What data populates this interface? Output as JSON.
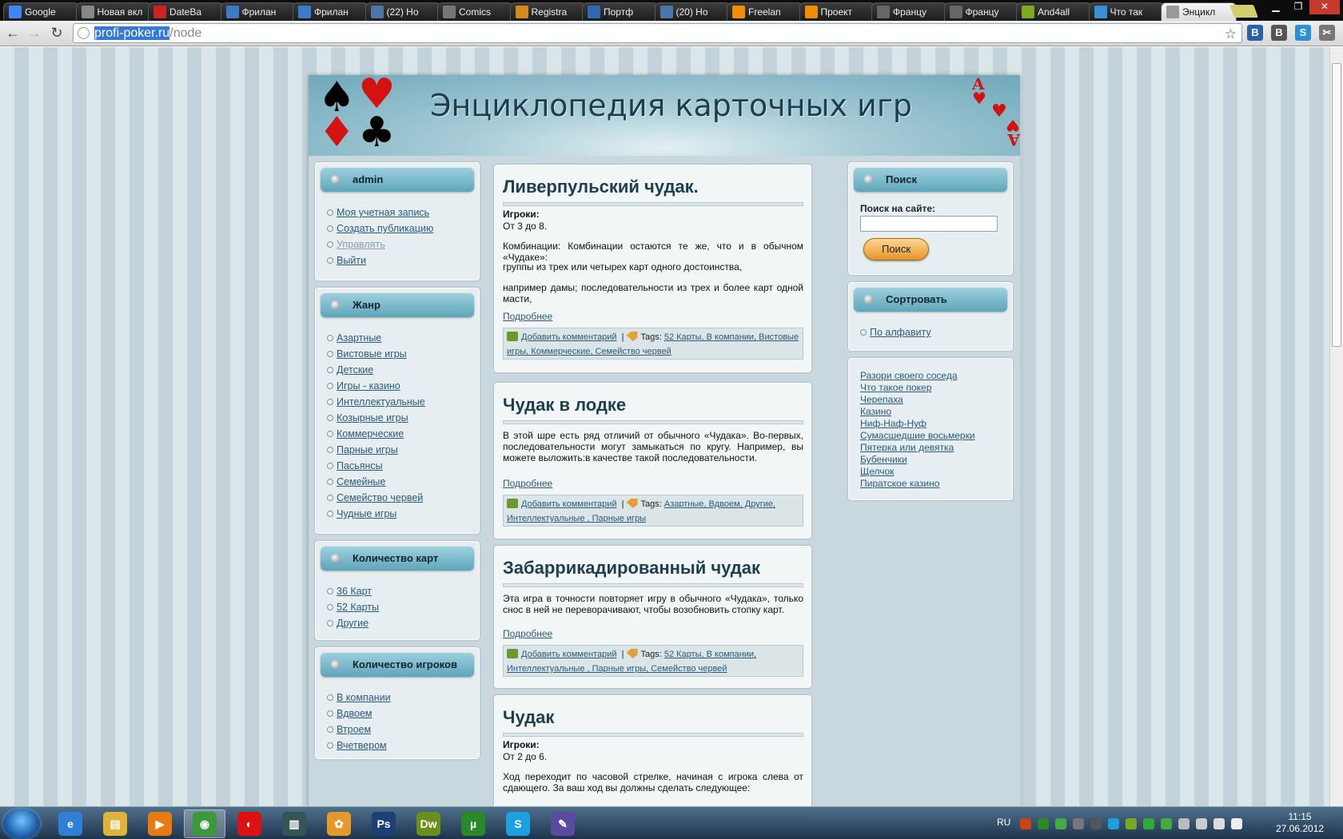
{
  "browser": {
    "tabs": [
      {
        "title": "Google",
        "icon": "google-icon",
        "color": "#4285f4"
      },
      {
        "title": "Новая вкл",
        "icon": "blank-page-icon",
        "color": "#888888"
      },
      {
        "title": "DateBa",
        "icon": "b-red-icon",
        "color": "#c22"
      },
      {
        "title": "Фрилан",
        "icon": "freelance-icon",
        "color": "#3a7bc8"
      },
      {
        "title": "Фрилан",
        "icon": "freelance-icon",
        "color": "#3a7bc8"
      },
      {
        "title": "(22) Но",
        "icon": "vk-icon",
        "color": "#4a76a8"
      },
      {
        "title": "Comics",
        "icon": "comics-icon",
        "color": "#777"
      },
      {
        "title": "Registra",
        "icon": "registration-icon",
        "color": "#d58a1a"
      },
      {
        "title": "Портф",
        "icon": "portfolio-icon",
        "color": "#2f69b0"
      },
      {
        "title": "(20) Но",
        "icon": "vk-icon",
        "color": "#4a76a8"
      },
      {
        "title": "Freelan",
        "icon": "f-orange-icon",
        "color": "#f28c00"
      },
      {
        "title": "Проект",
        "icon": "f-orange-icon",
        "color": "#f28c00"
      },
      {
        "title": "Францу",
        "icon": "french-icon",
        "color": "#666"
      },
      {
        "title": "Францу",
        "icon": "french-icon",
        "color": "#666"
      },
      {
        "title": "And4all",
        "icon": "android-icon",
        "color": "#7aaa22"
      },
      {
        "title": "Что так",
        "icon": "water-icon",
        "color": "#3b8fd6"
      },
      {
        "title": "Энцикл",
        "icon": "spade-icon",
        "color": "#999"
      }
    ],
    "url_host": "profi-poker.ru",
    "url_path": "/node",
    "extensions": [
      {
        "label": "В",
        "color": "#2a62a8"
      },
      {
        "label": "В",
        "color": "#555555"
      },
      {
        "label": "S",
        "color": "#2d8fd8"
      },
      {
        "label": "✂",
        "color": "#777777"
      }
    ]
  },
  "site": {
    "title": "Энциклопедия карточных игр"
  },
  "left": {
    "user": {
      "title": "admin",
      "items": [
        "Моя учетная запись",
        "Создать публикацию",
        "Управлять",
        "Выйти"
      ]
    },
    "genre": {
      "title": "Жанр",
      "items": [
        "Азартные",
        "Вистовые игры",
        "Детские",
        "Игры - казино",
        "Интеллектуальные",
        "Козырные игры",
        "Коммерческие",
        "Парные игры",
        "Пасьянсы",
        "Семейные",
        "Семейство червей",
        "Чудные игры"
      ]
    },
    "cards": {
      "title": "Количество карт",
      "items": [
        "36 Карт",
        "52 Карты",
        "Другие"
      ]
    },
    "players": {
      "title": "Количество игроков",
      "items": [
        "В компании",
        "Вдвоем",
        "Втроем",
        "Вчетвером"
      ]
    }
  },
  "nodes": [
    {
      "title": "Ливерпульский чудак.",
      "label": "Игроки:",
      "range": "От 3 до 8.",
      "p1": "Комбинации: Комбинации остаются те же, что и в обычном «Чудаке»:",
      "p2": "группы из трех или четырех карт одного достоинства,",
      "p3": "например дамы; последовательности из трех и более карт одной масти,",
      "more": "Подробнее",
      "comment": "Добавить комментарий",
      "tags_label": "Tags:",
      "tags": "52 Карты, В компании, Вистовые игры, Коммерческие, Семейство червей"
    },
    {
      "title": "Чудак в лодке",
      "p1": "В этой шре есть ряд отличий от обычного «Чудака». Во-первых, последовательности могут замыкаться по кругу. Например, вы можете выложить:в качестве такой последовательности.",
      "more": "Подробнее",
      "comment": "Добавить комментарий",
      "tags_label": "Tags:",
      "tags": "Азартные, Вдвоем, Другие, Интеллектуальные , Парные игры"
    },
    {
      "title": "Забаррикадированный чудак",
      "p1": "Эта игра в точности повторяет игру в обычного «Чудака», только снос в ней не переворачивают, чтобы возобновить стопку карт.",
      "more": "Подробнее",
      "comment": "Добавить комментарий",
      "tags_label": "Tags:",
      "tags": "52 Карты, В компании, Интеллектуальные , Парные игры, Семейство червей"
    },
    {
      "title": "Чудак",
      "label": "Игроки:",
      "range": "От 2 до 6.",
      "p1": "Ход переходит по часовой стрелке, начиная с игрока слева от сдающего. За ваш ход вы должны сделать следующее:"
    }
  ],
  "right": {
    "search": {
      "title": "Поиск",
      "label": "Поиск на сайте:",
      "value": "",
      "button": "Поиск"
    },
    "sort": {
      "title": "Сортровать",
      "items": [
        "По алфавиту"
      ]
    },
    "links": [
      "Разори своего соседа",
      "Что такое покер",
      "Черепаха",
      "Казино",
      "Ниф-Наф-Нуф",
      "Сумасшедшие восьмерки",
      "Пятерка или девятка",
      "Бубенчики",
      "Щелчок",
      "Пиратское казино"
    ]
  },
  "taskbar": {
    "apps": [
      {
        "name": "ie-icon",
        "label": "e",
        "color": "#2f7fd6"
      },
      {
        "name": "explorer-icon",
        "label": "▤",
        "color": "#e0b23a"
      },
      {
        "name": "media-player-icon",
        "label": "▶",
        "color": "#e87a14"
      },
      {
        "name": "chrome-icon",
        "label": "◉",
        "color": "#3a9a3a"
      },
      {
        "name": "acdsee-icon",
        "label": "◐",
        "color": "#d11"
      },
      {
        "name": "dreamweaver-app-icon",
        "label": "▥",
        "color": "#355"
      },
      {
        "name": "paint-icon",
        "label": "✿",
        "color": "#e49a2a"
      },
      {
        "name": "photoshop-icon",
        "label": "Ps",
        "color": "#1c3f74"
      },
      {
        "name": "dreamweaver-icon",
        "label": "Dw",
        "color": "#6a8f1c"
      },
      {
        "name": "utorrent-icon",
        "label": "µ",
        "color": "#2a8a2a"
      },
      {
        "name": "skype-icon",
        "label": "S",
        "color": "#1ea0e0"
      },
      {
        "name": "screenshot-tool-icon",
        "label": "✎",
        "color": "#5a4aa0"
      }
    ],
    "lang": "RU",
    "time": "11:15",
    "date": "27.06.2012"
  }
}
